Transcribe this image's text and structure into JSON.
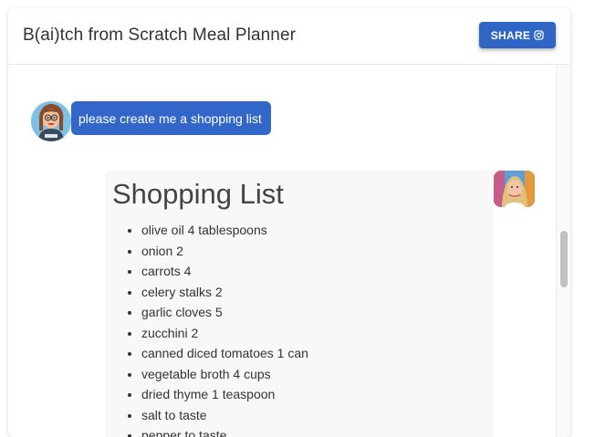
{
  "header": {
    "title": "B(ai)tch from Scratch Meal Planner",
    "share_label": "SHARE"
  },
  "icons": {
    "share": "instagram-icon",
    "user_avatar": "cartoon-woman-avatar",
    "bot_avatar": "woman-photo-avatar"
  },
  "colors": {
    "accent": "#2f66c5",
    "user_bubble": "#3267c9",
    "bot_card": "#f8f8f8"
  },
  "messages": {
    "user": {
      "text": "please create me a shopping list"
    },
    "bot": {
      "title": "Shopping List",
      "items": [
        "olive oil 4 tablespoons",
        "onion 2",
        "carrots 4",
        "celery stalks 2",
        "garlic cloves 5",
        "zucchini 2",
        "canned diced tomatoes 1 can",
        "vegetable broth 4 cups",
        "dried thyme 1 teaspoon",
        "salt to taste",
        "pepper to taste"
      ]
    }
  }
}
